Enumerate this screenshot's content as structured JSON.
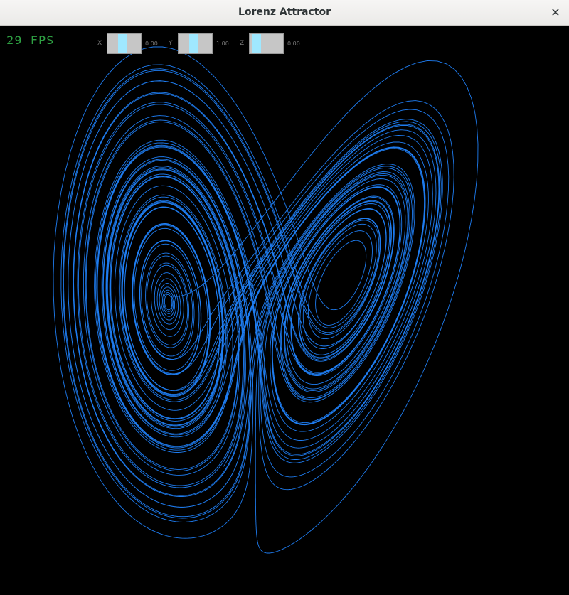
{
  "window": {
    "title": "Lorenz Attractor",
    "close_glyph": "✕"
  },
  "hud": {
    "fps_text": "29 FPS",
    "fps_color": "#2ea043"
  },
  "sliders": [
    {
      "label": "X",
      "value": "0.00",
      "level": 0.45
    },
    {
      "label": "Y",
      "value": "1.00",
      "level": 0.45
    },
    {
      "label": "Z",
      "value": "0.00",
      "level": 0.1
    }
  ],
  "attractor": {
    "line_color": "#1e7cf0",
    "system": "lorenz"
  }
}
